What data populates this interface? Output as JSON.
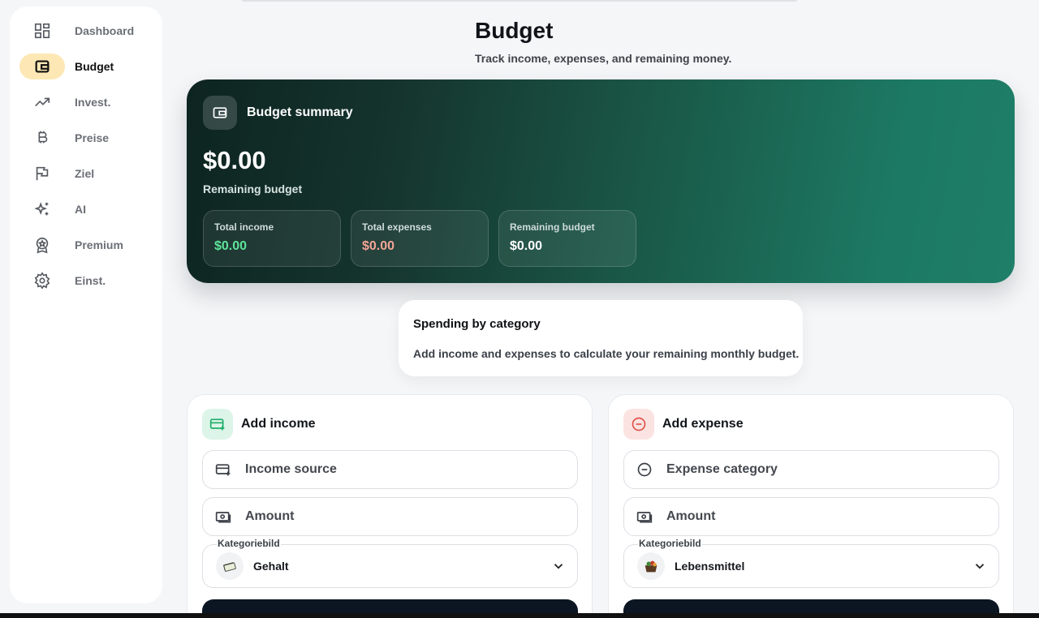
{
  "sidebar": {
    "items": [
      {
        "label": "Dashboard",
        "icon": "dashboard-icon"
      },
      {
        "label": "Budget",
        "icon": "wallet-icon",
        "active": true
      },
      {
        "label": "Invest.",
        "icon": "trending-up-icon"
      },
      {
        "label": "Preise",
        "icon": "bitcoin-icon"
      },
      {
        "label": "Ziel",
        "icon": "flag-icon"
      },
      {
        "label": "AI",
        "icon": "sparkles-icon"
      },
      {
        "label": "Premium",
        "icon": "award-icon"
      },
      {
        "label": "Einst.",
        "icon": "settings-icon"
      }
    ]
  },
  "header": {
    "title": "Budget",
    "subtitle": "Track income, expenses, and remaining money."
  },
  "summary": {
    "title": "Budget summary",
    "amount": "$0.00",
    "amount_label": "Remaining budget",
    "stats": [
      {
        "label": "Total income",
        "value": "$0.00",
        "color": "#5ee39a"
      },
      {
        "label": "Total expenses",
        "value": "$0.00",
        "color": "#f5a597"
      },
      {
        "label": "Remaining budget",
        "value": "$0.00",
        "color": "#ffffff"
      }
    ]
  },
  "spending": {
    "title": "Spending by category",
    "text": "Add income and expenses to calculate your remaining monthly budget."
  },
  "income_form": {
    "title": "Add income",
    "source_placeholder": "Income source",
    "amount_placeholder": "Amount",
    "category_label": "Kategoriebild",
    "category_value": "Gehalt"
  },
  "expense_form": {
    "title": "Add expense",
    "category_placeholder": "Expense category",
    "amount_placeholder": "Amount",
    "category_label": "Kategoriebild",
    "category_value": "Lebensmittel"
  },
  "colors": {
    "accent_active": "#fde8b5",
    "income_accent": "#1fae6a",
    "expense_accent": "#e0524a",
    "button_dark": "#0c1522"
  }
}
